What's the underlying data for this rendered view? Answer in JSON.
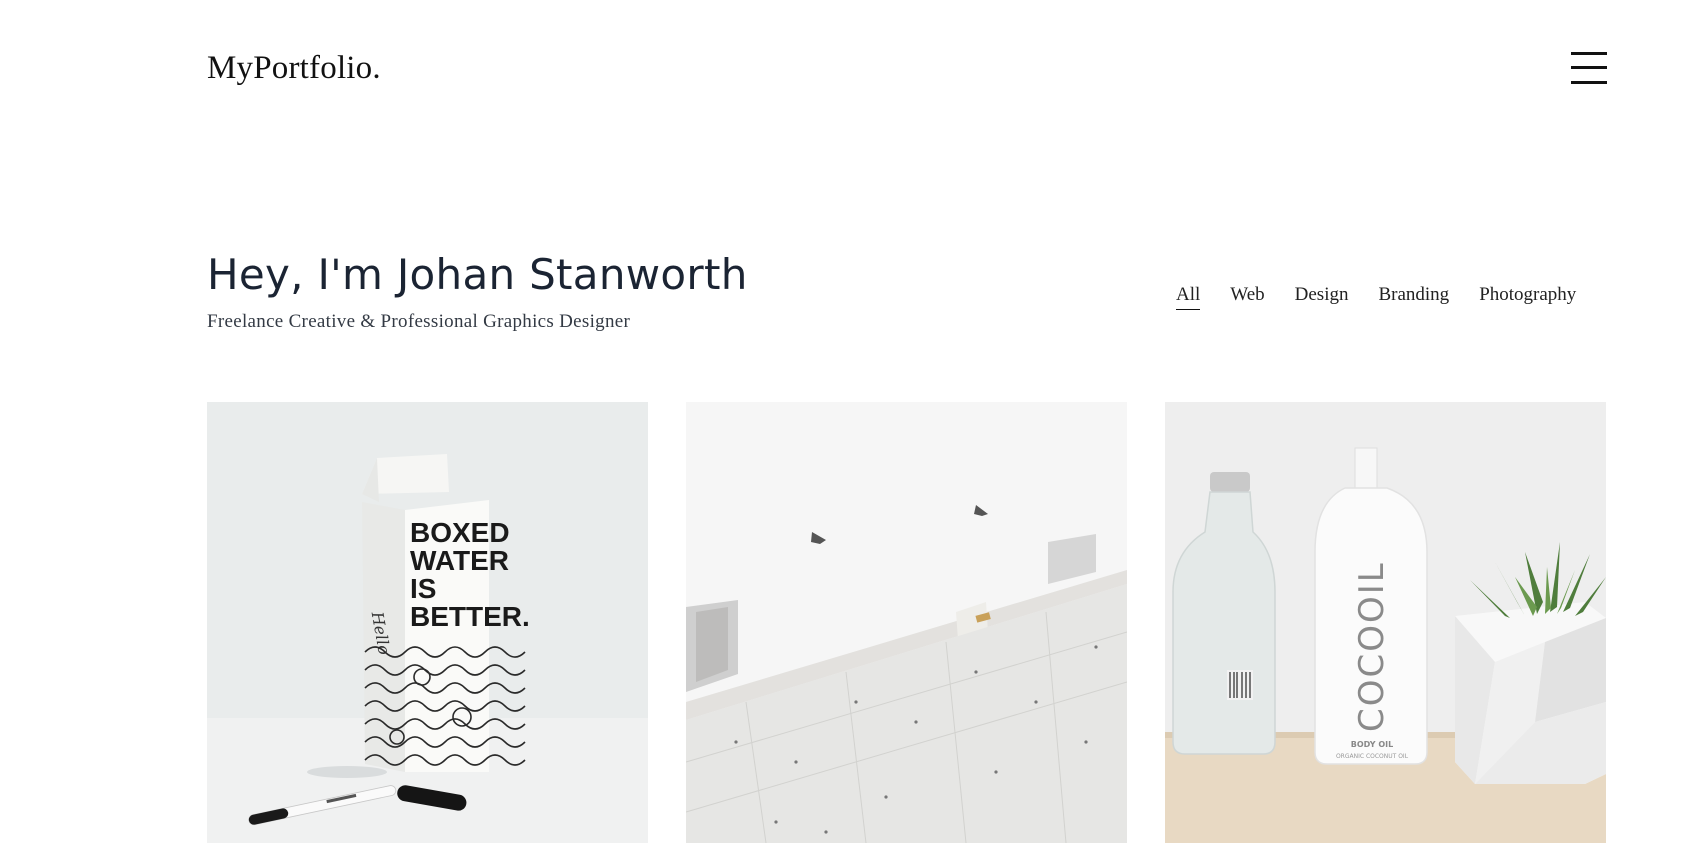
{
  "header": {
    "logo": "MyPortfolio.",
    "menu_icon": "hamburger-menu-icon"
  },
  "intro": {
    "title": "Hey, I'm Johan Stanworth",
    "subtitle": "Freelance Creative & Professional Graphics Designer"
  },
  "filters": {
    "active": "All",
    "items": [
      "All",
      "Web",
      "Design",
      "Branding",
      "Photography"
    ]
  },
  "portfolio": {
    "items": [
      {
        "image": "boxed-water-carton-photo",
        "carton_text": [
          "BOXED",
          "WATER",
          "IS",
          "BETTER."
        ],
        "script_text": "Hello"
      },
      {
        "image": "white-architecture-photo"
      },
      {
        "image": "cocooil-bottle-photo",
        "brand_text": "COCOOIL",
        "label_line1": "BODY OIL",
        "label_line2": "ORGANIC COCONUT OIL"
      }
    ]
  }
}
